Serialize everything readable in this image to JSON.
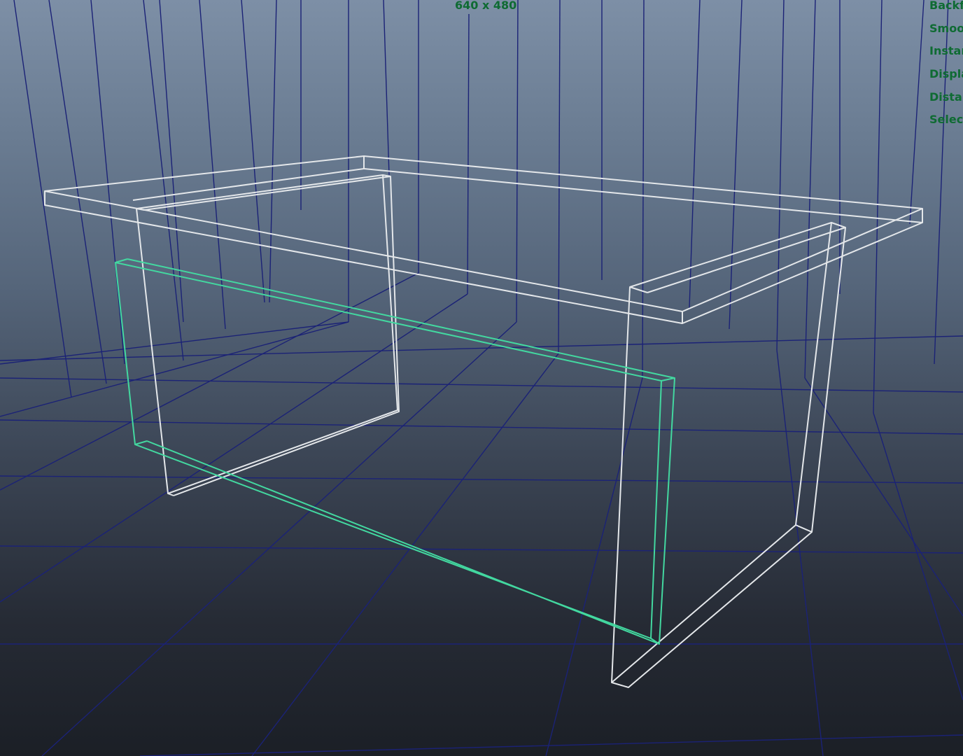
{
  "viewport": {
    "resolution_gate_label": "640 x 480",
    "hud_labels": [
      "Backf",
      "Smoo",
      "Instar",
      "Displa",
      "Distar",
      "Selec"
    ],
    "colors": {
      "grid": "#1b2276",
      "wireframe": "#e4e7ea",
      "selection": "#43d8a0",
      "hud_text": "#0f6b33"
    }
  }
}
